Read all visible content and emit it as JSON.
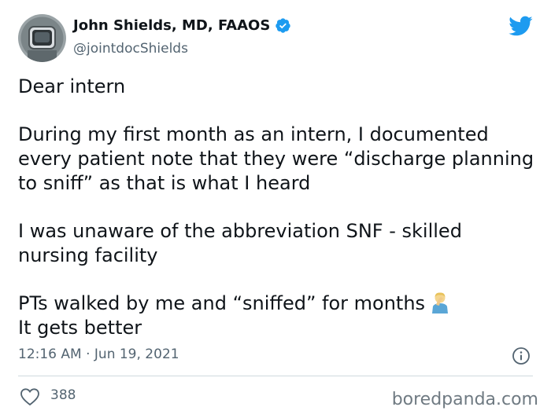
{
  "author": {
    "name": "John Shields, MD, FAAOS",
    "handle": "@jointdocShields",
    "verified": true,
    "avatar_icon": "astronaut-helmet-avatar"
  },
  "tweet": {
    "paragraphs": [
      "Dear intern",
      "During my first month as an intern, I documented every patient note that they were “discharge planning to sniff” as that is what I heard",
      "I was unaware of the abbreviation SNF - skilled nursing facility",
      "PTs walked by me and “sniffed” for months",
      "It gets better"
    ],
    "emoji": "facepalm-emoji"
  },
  "meta": {
    "timestamp": "12:16 AM · Jun 19, 2021"
  },
  "engagement": {
    "likes": "388"
  },
  "watermark": "boredpanda.com",
  "colors": {
    "twitter_blue": "#1d9bf0",
    "text": "#0f1419",
    "secondary": "#536471"
  }
}
